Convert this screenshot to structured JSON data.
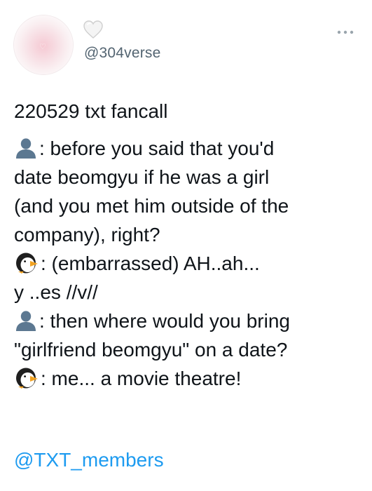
{
  "author": {
    "handle": "@304verse",
    "avatar_heart": "♡"
  },
  "icons": {
    "name_emoji": "white-heart-icon",
    "more": "more-dots-icon",
    "speaker_a": "bust-silhouette-icon",
    "speaker_b": "penguin-icon"
  },
  "tweet": {
    "date_line": "220529 txt fancall",
    "lines": [
      {
        "speaker": "a",
        "text": ": before you said that you'd"
      },
      {
        "speaker": "",
        "text": "date beomgyu if he was a girl"
      },
      {
        "speaker": "",
        "text": "(and you met him outside of the"
      },
      {
        "speaker": "",
        "text": "company), right?"
      },
      {
        "speaker": "b",
        "text": ": (embarrassed) AH..ah..."
      },
      {
        "speaker": "",
        "text": "y ..es //v//"
      },
      {
        "speaker": "a",
        "text": ": then where would you bring"
      },
      {
        "speaker": "",
        "text": "\"girlfriend beomgyu\" on a date?"
      },
      {
        "speaker": "b",
        "text": ": me... a movie theatre!"
      }
    ]
  },
  "mention": "@TXT_members",
  "colors": {
    "text": "#0f1419",
    "handle": "#536471",
    "link": "#1d9bf0"
  }
}
